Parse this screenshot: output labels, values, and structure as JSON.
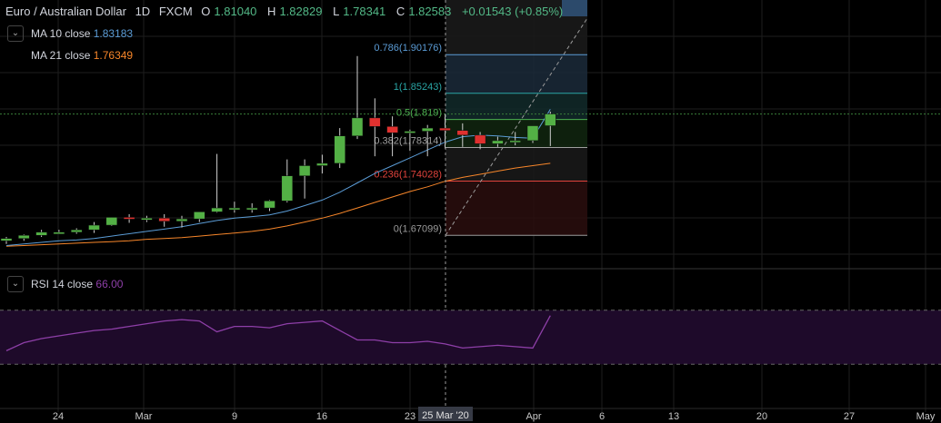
{
  "header": {
    "symbol_name": "Euro / Australian Dollar",
    "interval": "1D",
    "exchange": "FXCM",
    "open_label": "O",
    "open": "1.81040",
    "high_label": "H",
    "high": "1.82829",
    "low_label": "L",
    "low": "1.78341",
    "close_label": "C",
    "close": "1.82583",
    "change": "+0.01543 (+0.85%)"
  },
  "indicators": {
    "ma10": {
      "label": "MA 10 close",
      "value": "1.83183",
      "color": "#5b9cd6"
    },
    "ma21": {
      "label": "MA 21 close",
      "value": "1.76349",
      "color": "#f7862a"
    },
    "rsi": {
      "label": "RSI 14 close",
      "value": "66.00",
      "color": "#8e3fa8"
    }
  },
  "colors": {
    "up": "#53b045",
    "down": "#e0312f",
    "grid": "#1e1e1e",
    "price_line": "#3a7d3a",
    "rsi_band": "#1e0a2a"
  },
  "icons": {
    "collapse": "chevron-down-icon",
    "menu": "menu-icon"
  },
  "crosshair_label": "25 Mar '20",
  "chart_data": {
    "type": "candlestick",
    "x": [
      "2020-02-20",
      "2020-02-21",
      "2020-02-24",
      "2020-02-25",
      "2020-02-26",
      "2020-02-27",
      "2020-02-28",
      "2020-03-02",
      "2020-03-03",
      "2020-03-04",
      "2020-03-05",
      "2020-03-06",
      "2020-03-09",
      "2020-03-10",
      "2020-03-11",
      "2020-03-12",
      "2020-03-13",
      "2020-03-16",
      "2020-03-17",
      "2020-03-18",
      "2020-03-19",
      "2020-03-20",
      "2020-03-23",
      "2020-03-24",
      "2020-03-25",
      "2020-03-26",
      "2020-03-27",
      "2020-03-30",
      "2020-03-31",
      "2020-04-01",
      "2020-04-02",
      "2020-04-03"
    ],
    "x_tick_labels": [
      "24",
      "Mar",
      "9",
      "16",
      "23",
      "Apr",
      "6",
      "13",
      "20",
      "27",
      "May"
    ],
    "series": [
      {
        "open": [
          1.664,
          1.667,
          1.671,
          1.675,
          1.675,
          1.678,
          1.684,
          1.694,
          1.693,
          1.693,
          1.689,
          1.692,
          1.701,
          1.706,
          1.706,
          1.706,
          1.715,
          1.747,
          1.76,
          1.763,
          1.798,
          1.821,
          1.81,
          1.802,
          1.804,
          1.808,
          1.805,
          1.799,
          1.788,
          1.792,
          1.792,
          1.811
        ],
        "high": [
          1.669,
          1.672,
          1.678,
          1.678,
          1.68,
          1.688,
          1.694,
          1.698,
          1.696,
          1.698,
          1.696,
          1.7,
          1.775,
          1.714,
          1.712,
          1.716,
          1.768,
          1.768,
          1.774,
          1.808,
          1.9,
          1.846,
          1.823,
          1.806,
          1.812,
          1.826,
          1.814,
          1.803,
          1.797,
          1.803,
          1.8,
          1.829
        ],
        "low": [
          1.66,
          1.664,
          1.669,
          1.673,
          1.673,
          1.674,
          1.683,
          1.687,
          1.688,
          1.682,
          1.681,
          1.688,
          1.7,
          1.7,
          1.7,
          1.702,
          1.713,
          1.718,
          1.75,
          1.757,
          1.794,
          1.772,
          1.772,
          1.779,
          1.772,
          1.782,
          1.784,
          1.781,
          1.784,
          1.786,
          1.789,
          1.785
        ],
        "close": [
          1.667,
          1.671,
          1.675,
          1.675,
          1.678,
          1.684,
          1.694,
          1.693,
          1.693,
          1.689,
          1.692,
          1.701,
          1.706,
          1.706,
          1.706,
          1.715,
          1.747,
          1.76,
          1.763,
          1.798,
          1.821,
          1.81,
          1.802,
          1.804,
          1.808,
          1.805,
          1.799,
          1.788,
          1.792,
          1.792,
          1.811,
          1.826
        ]
      }
    ],
    "ma10": [
      1.658,
      1.66,
      1.662,
      1.664,
      1.665,
      1.667,
      1.67,
      1.673,
      1.676,
      1.679,
      1.682,
      1.686,
      1.69,
      1.693,
      1.695,
      1.697,
      1.702,
      1.709,
      1.716,
      1.726,
      1.738,
      1.75,
      1.76,
      1.77,
      1.78,
      1.79,
      1.797,
      1.799,
      1.798,
      1.796,
      1.795,
      1.832
    ],
    "ma21": [
      1.657,
      1.658,
      1.659,
      1.66,
      1.661,
      1.662,
      1.663,
      1.664,
      1.666,
      1.667,
      1.668,
      1.67,
      1.672,
      1.674,
      1.676,
      1.679,
      1.683,
      1.688,
      1.693,
      1.699,
      1.706,
      1.713,
      1.72,
      1.727,
      1.733,
      1.74,
      1.745,
      1.749,
      1.753,
      1.757,
      1.76,
      1.763
    ],
    "rsi": [
      40,
      46,
      49,
      51,
      53,
      55,
      56,
      58,
      60,
      62,
      63,
      62,
      54,
      58,
      58,
      57,
      60,
      61,
      62,
      55,
      48,
      48,
      46,
      46,
      47,
      45,
      42,
      43,
      44,
      43,
      42,
      66
    ],
    "fib_levels": [
      {
        "ratio": "0.786",
        "value": 1.90176,
        "label": "0.786(1.90176)",
        "color": "#5b9cd6"
      },
      {
        "ratio": "1",
        "value": 1.85243,
        "label": "1(1.85243)",
        "color": "#2aa6a6"
      },
      {
        "ratio": "0.5",
        "value": 1.81901,
        "label": "0.5(1.819)",
        "color": "#4caf50"
      },
      {
        "ratio": "0.382",
        "value": 1.78314,
        "label": "0.382(1.78314)",
        "color": "#a0a0a0"
      },
      {
        "ratio": "0.236",
        "value": 1.74028,
        "label": "0.236(1.74028)",
        "color": "#e0433c"
      },
      {
        "ratio": "0",
        "value": 1.67099,
        "label": "0(1.67099)",
        "color": "#9a9a9a"
      }
    ],
    "ylim": [
      1.64,
      1.96
    ],
    "rsi_ylim": [
      0,
      100
    ],
    "rsi_band": [
      30,
      70
    ],
    "grid": true,
    "legend_position": "top-left"
  }
}
